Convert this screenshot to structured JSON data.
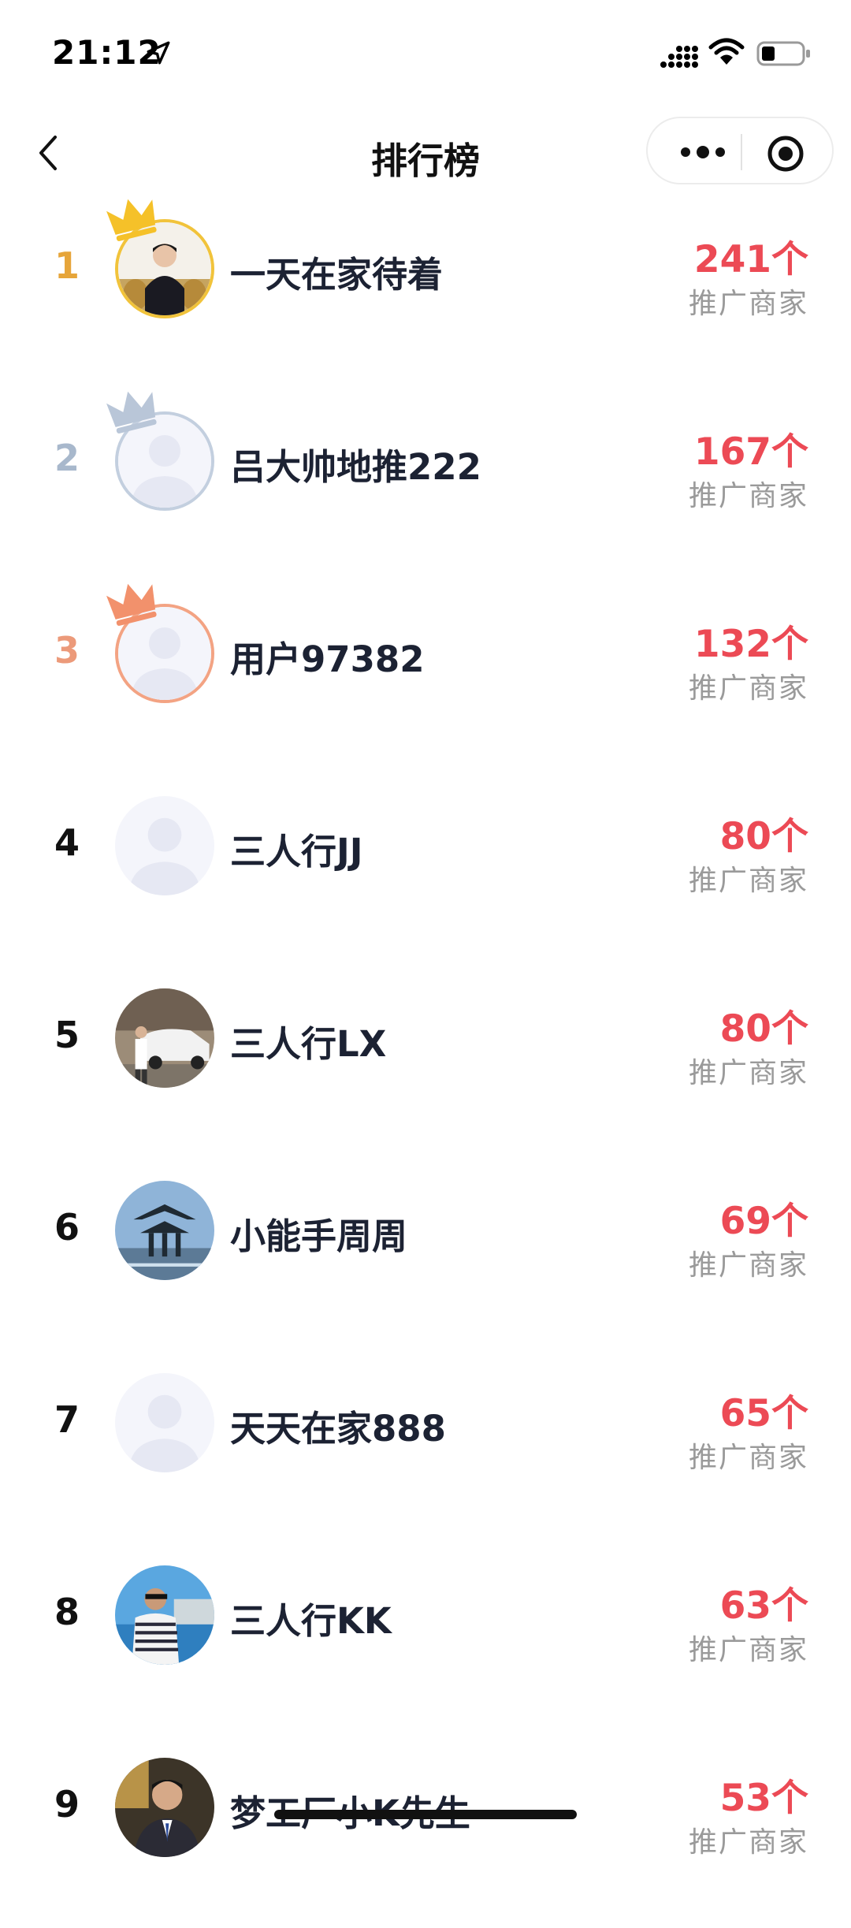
{
  "status_bar": {
    "time": "21:12",
    "icons": [
      "location-arrow-icon",
      "cellular-signal-icon",
      "wifi-icon",
      "battery-icon"
    ]
  },
  "nav": {
    "title": "排行榜",
    "back_icon": "chevron-left-icon",
    "capsule_icons": [
      "more-dots-icon",
      "target-circle-icon"
    ]
  },
  "colors": {
    "accent_count": "#ec4a55",
    "rank_gold": "#e6a53a",
    "rank_silver": "#a8b8cc",
    "rank_bronze": "#ec9a7a",
    "sublabel_gray": "#9a9a9a"
  },
  "ranking": [
    {
      "rank": "1",
      "name": "一天在家待着",
      "count": "241个",
      "label": "推广商家",
      "avatar": "photo-person-trophies",
      "crown": "gold-crown-icon"
    },
    {
      "rank": "2",
      "name": "吕大帅地推222",
      "count": "167个",
      "label": "推广商家",
      "avatar": "default-avatar",
      "crown": "silver-crown-icon"
    },
    {
      "rank": "3",
      "name": "用户97382",
      "count": "132个",
      "label": "推广商家",
      "avatar": "default-avatar",
      "crown": "bronze-crown-icon"
    },
    {
      "rank": "4",
      "name": "三人行JJ",
      "count": "80个",
      "label": "推广商家",
      "avatar": "default-avatar"
    },
    {
      "rank": "5",
      "name": "三人行LX",
      "count": "80个",
      "label": "推广商家",
      "avatar": "photo-person-car"
    },
    {
      "rank": "6",
      "name": "小能手周周",
      "count": "69个",
      "label": "推广商家",
      "avatar": "photo-pavilion"
    },
    {
      "rank": "7",
      "name": "天天在家888",
      "count": "65个",
      "label": "推广商家",
      "avatar": "default-avatar"
    },
    {
      "rank": "8",
      "name": "三人行KK",
      "count": "63个",
      "label": "推广商家",
      "avatar": "photo-person-beach"
    },
    {
      "rank": "9",
      "name": "梦工厂小K先生",
      "count": "53个",
      "label": "推广商家",
      "avatar": "photo-person-portrait"
    }
  ]
}
